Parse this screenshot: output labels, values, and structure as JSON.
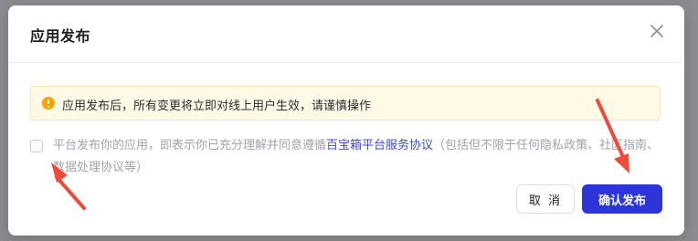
{
  "dialog": {
    "title": "应用发布",
    "close_icon": "close-icon"
  },
  "notice": {
    "icon": "warning-icon",
    "text": "应用发布后，所有变更将立即对线上用户生效，请谨慎操作"
  },
  "agreement": {
    "checked": false,
    "text_before": "平台发布你的应用，即表示你已充分理解并同意遵循",
    "link_text": "百宝箱平台服务协议",
    "text_after": "（包括但不限于任何隐私政策、社区指南、数据处理协议等）"
  },
  "buttons": {
    "cancel_label": "取 消",
    "confirm_label": "确认发布"
  },
  "colors": {
    "accent": "#2d35d8",
    "link": "#3d49d8",
    "warning": "#f7a400",
    "annotation_arrow": "#ef4b3c"
  }
}
